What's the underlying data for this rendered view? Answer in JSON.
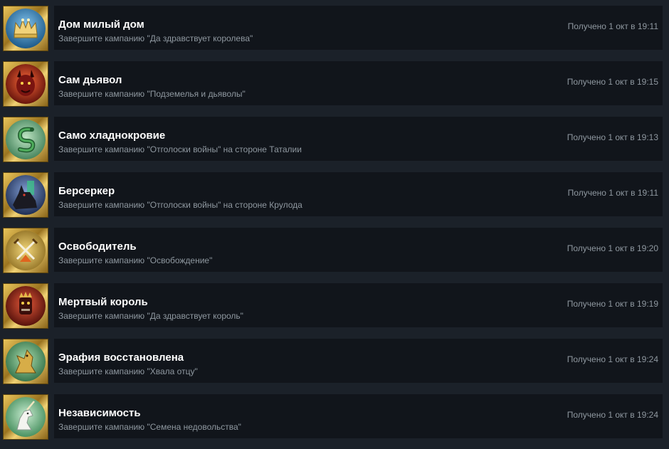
{
  "achievements": [
    {
      "title": "Дом милый дом",
      "description": "Завершите кампанию \"Да здравствует королева\"",
      "unlocked": "Получено 1 окт в 19:11",
      "icon": "crown-icon",
      "icon_bg": "#2b6fa0"
    },
    {
      "title": "Сам дьявол",
      "description": "Завершите кампанию \"Подземелья и дьяволы\"",
      "unlocked": "Получено 1 окт в 19:15",
      "icon": "devil-icon",
      "icon_bg": "#a5281c"
    },
    {
      "title": "Само хладнокровие",
      "description": "Завершите кампанию \"Отголоски войны\" на стороне Таталии",
      "unlocked": "Получено 1 окт в 19:13",
      "icon": "snake-icon",
      "icon_bg": "#3f8a5a"
    },
    {
      "title": "Берсеркер",
      "description": "Завершите кампанию \"Отголоски войны\" на стороне Крулода",
      "unlocked": "Получено 1 окт в 19:11",
      "icon": "wolf-icon",
      "icon_bg": "#2f4f82"
    },
    {
      "title": "Освободитель",
      "description": "Завершите кампанию \"Освобождение\"",
      "unlocked": "Получено 1 окт в 19:20",
      "icon": "crossed-swords-icon",
      "icon_bg": "#c79a2a"
    },
    {
      "title": "Мертвый король",
      "description": "Завершите кампанию \"Да здравствует король\"",
      "unlocked": "Получено 1 окт в 19:19",
      "icon": "dead-king-icon",
      "icon_bg": "#8c2820"
    },
    {
      "title": "Эрафия восстановлена",
      "description": "Завершите кампанию \"Хвала отцу\"",
      "unlocked": "Получено 1 окт в 19:24",
      "icon": "griffin-icon",
      "icon_bg": "#3b8a54"
    },
    {
      "title": "Независимость",
      "description": "Завершите кампанию \"Семена недовольства\"",
      "unlocked": "Получено 1 окт в 19:24",
      "icon": "unicorn-icon",
      "icon_bg": "#4f9a68"
    }
  ]
}
